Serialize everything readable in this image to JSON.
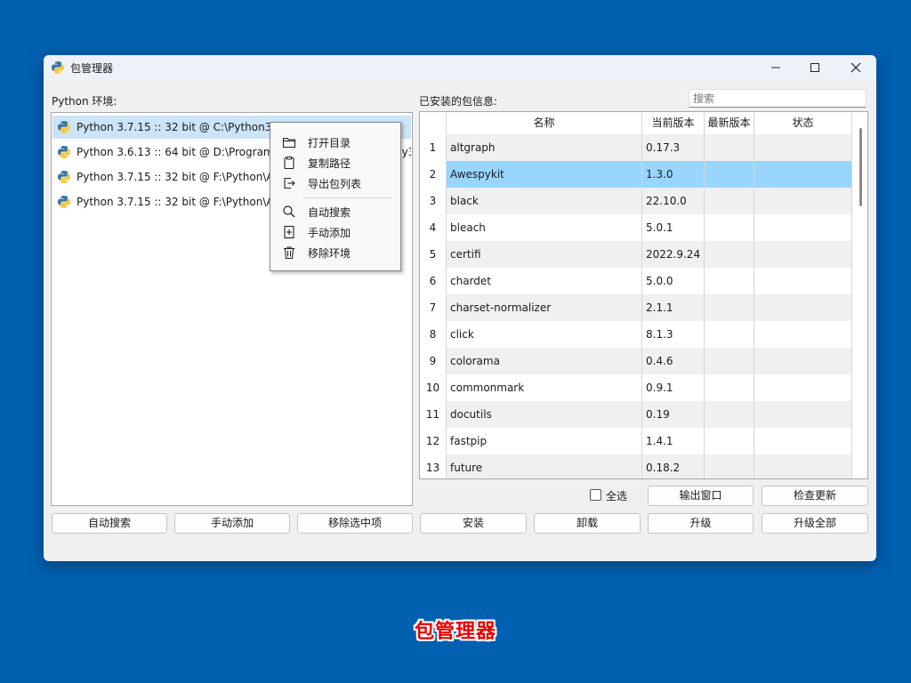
{
  "window": {
    "title": "包管理器",
    "minimize_icon": "minimize-icon",
    "maximize_icon": "maximize-icon",
    "close_icon": "close-icon"
  },
  "left": {
    "label": "Python 环境:",
    "environments": [
      {
        "text": "Python 3.7.15 :: 32 bit @ C:\\Python37",
        "selected": true
      },
      {
        "text": "Python 3.6.13 :: 64 bit @ D:\\ProgramData\\Anaconda3\\envs\\py36",
        "selected": false
      },
      {
        "text": "Python 3.7.15 :: 32 bit @ F:\\Python\\AutoTest",
        "selected": false
      },
      {
        "text": "Python 3.7.15 :: 32 bit @ F:\\Python\\Awespykit",
        "selected": false
      }
    ],
    "buttons": {
      "auto_search": "自动搜索",
      "manual_add": "手动添加",
      "remove_selected": "移除选中项"
    }
  },
  "context_menu": {
    "items": [
      {
        "label": "打开目录",
        "icon": "folder-open-icon"
      },
      {
        "label": "复制路径",
        "icon": "clipboard-icon"
      },
      {
        "label": "导出包列表",
        "icon": "export-icon"
      },
      {
        "label": "自动搜索",
        "icon": "search-icon"
      },
      {
        "label": "手动添加",
        "icon": "add-file-icon"
      },
      {
        "label": "移除环境",
        "icon": "trash-icon"
      }
    ]
  },
  "right": {
    "label": "已安装的包信息:",
    "search_placeholder": "搜索",
    "columns": [
      "名称",
      "当前版本",
      "最新版本",
      "状态"
    ],
    "rows": [
      {
        "num": "1",
        "name": "altgraph",
        "version": "0.17.3",
        "latest": "",
        "status": ""
      },
      {
        "num": "2",
        "name": "Awespykit",
        "version": "1.3.0",
        "latest": "",
        "status": ""
      },
      {
        "num": "3",
        "name": "black",
        "version": "22.10.0",
        "latest": "",
        "status": ""
      },
      {
        "num": "4",
        "name": "bleach",
        "version": "5.0.1",
        "latest": "",
        "status": ""
      },
      {
        "num": "5",
        "name": "certifi",
        "version": "2022.9.24",
        "latest": "",
        "status": ""
      },
      {
        "num": "6",
        "name": "chardet",
        "version": "5.0.0",
        "latest": "",
        "status": ""
      },
      {
        "num": "7",
        "name": "charset-normalizer",
        "version": "2.1.1",
        "latest": "",
        "status": ""
      },
      {
        "num": "8",
        "name": "click",
        "version": "8.1.3",
        "latest": "",
        "status": ""
      },
      {
        "num": "9",
        "name": "colorama",
        "version": "0.4.6",
        "latest": "",
        "status": ""
      },
      {
        "num": "10",
        "name": "commonmark",
        "version": "0.9.1",
        "latest": "",
        "status": ""
      },
      {
        "num": "11",
        "name": "docutils",
        "version": "0.19",
        "latest": "",
        "status": ""
      },
      {
        "num": "12",
        "name": "fastpip",
        "version": "1.4.1",
        "latest": "",
        "status": ""
      },
      {
        "num": "13",
        "name": "future",
        "version": "0.18.2",
        "latest": "",
        "status": ""
      }
    ],
    "selected_row": 2,
    "select_all": "全选",
    "buttons": {
      "output_window": "输出窗口",
      "check_updates": "检查更新",
      "install": "安装",
      "uninstall": "卸载",
      "upgrade": "升级",
      "upgrade_all": "升级全部"
    }
  },
  "caption": "包管理器",
  "colors": {
    "desktop": "#0160b0",
    "selected_row": "#99d6ff",
    "selected_env": "#cce4f7",
    "caption": "#e80000"
  }
}
